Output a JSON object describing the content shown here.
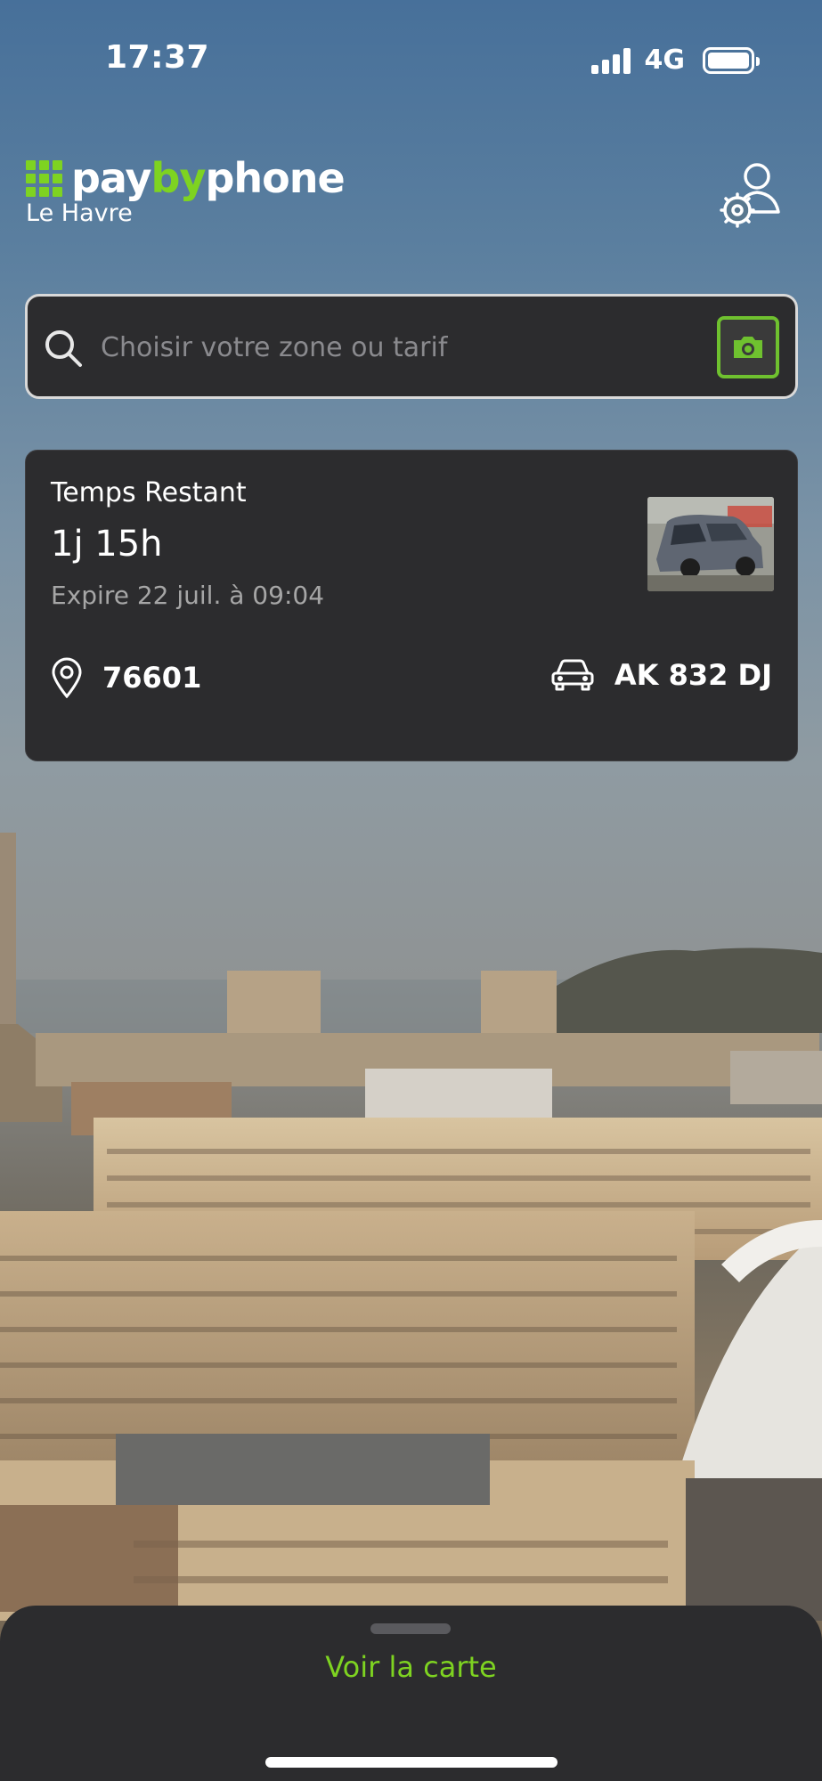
{
  "status_bar": {
    "time": "17:37",
    "network": "4G",
    "battery_level": 1.0
  },
  "header": {
    "brand": {
      "pay": "pay",
      "by": "by",
      "phone": "phone"
    },
    "city": "Le Havre",
    "account_icon": "user-settings-icon"
  },
  "search": {
    "placeholder": "Choisir votre zone ou tarif",
    "value": "",
    "search_icon": "search-icon",
    "camera_icon": "camera-icon"
  },
  "session": {
    "label": "Temps Restant",
    "remaining": "1j 15h",
    "expires": "Expire 22 juil. à 09:04",
    "zone": "76601",
    "plate": "AK 832 DJ",
    "zone_icon": "location-pin-icon",
    "vehicle_icon": "car-icon"
  },
  "bottom_sheet": {
    "map_link": "Voir la carte"
  },
  "colors": {
    "brand_green": "#7ed321",
    "card_bg": "#2c2c2e"
  }
}
